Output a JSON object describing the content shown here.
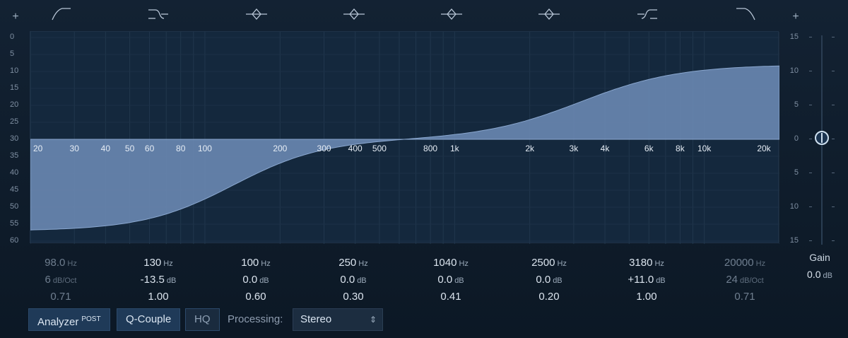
{
  "plus_label": "+",
  "left_scale": [
    "0",
    "5",
    "10",
    "15",
    "20",
    "25",
    "30",
    "35",
    "40",
    "45",
    "50",
    "55",
    "60"
  ],
  "right_scale": [
    "15",
    "10",
    "5",
    "0",
    "5",
    "10",
    "15"
  ],
  "freq_labels": [
    "20",
    "30",
    "40",
    "50",
    "60",
    "80",
    "100",
    "200",
    "300",
    "400",
    "500",
    "800",
    "1k",
    "2k",
    "3k",
    "4k",
    "6k",
    "8k",
    "10k",
    "20k"
  ],
  "band_icons": [
    "low-cut-icon",
    "low-shelf-icon",
    "peak-icon",
    "peak-icon",
    "peak-icon",
    "peak-icon",
    "high-shelf-icon",
    "high-cut-icon"
  ],
  "bands": [
    {
      "freq": "98.0",
      "freq_unit": "Hz",
      "gain": "6",
      "gain_unit": "dB/Oct",
      "q": "0.71"
    },
    {
      "freq": "130",
      "freq_unit": "Hz",
      "gain": "-13.5",
      "gain_unit": "dB",
      "q": "1.00"
    },
    {
      "freq": "100",
      "freq_unit": "Hz",
      "gain": "0.0",
      "gain_unit": "dB",
      "q": "0.60"
    },
    {
      "freq": "250",
      "freq_unit": "Hz",
      "gain": "0.0",
      "gain_unit": "dB",
      "q": "0.30"
    },
    {
      "freq": "1040",
      "freq_unit": "Hz",
      "gain": "0.0",
      "gain_unit": "dB",
      "q": "0.41"
    },
    {
      "freq": "2500",
      "freq_unit": "Hz",
      "gain": "0.0",
      "gain_unit": "dB",
      "q": "0.20"
    },
    {
      "freq": "3180",
      "freq_unit": "Hz",
      "gain": "+11.0",
      "gain_unit": "dB",
      "q": "1.00"
    },
    {
      "freq": "20000",
      "freq_unit": "Hz",
      "gain": "24",
      "gain_unit": "dB/Oct",
      "q": "0.71"
    }
  ],
  "gain": {
    "title": "Gain",
    "value": "0.0",
    "unit": "dB"
  },
  "controls": {
    "analyzer": "Analyzer",
    "analyzer_post": "POST",
    "q_couple": "Q-Couple",
    "hq": "HQ",
    "processing_label": "Processing:",
    "processing_value": "Stereo"
  },
  "colors": {
    "curve_fill": "#6e8db8",
    "accent": "#1f3a58"
  }
}
